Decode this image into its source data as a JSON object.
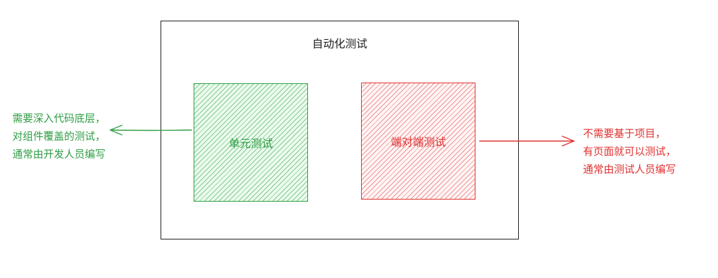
{
  "frame": {
    "title": "自动化测试"
  },
  "boxes": {
    "unit": {
      "label": "单元测试",
      "color": "#2f9e44"
    },
    "e2e": {
      "label": "端对端测试",
      "color": "#e03131"
    }
  },
  "notes": {
    "left": {
      "lines": [
        "需要深入代码底层，",
        "对组件覆盖的测试，",
        "通常由开发人员编写"
      ],
      "color": "#2f9e44"
    },
    "right": {
      "lines": [
        "不需要基于项目，",
        "有页面就可以测试，",
        "通常由测试人员编写"
      ],
      "color": "#e03131"
    }
  },
  "arrows": {
    "unit_to_note": "arrow-left",
    "e2e_to_note": "arrow-right"
  }
}
